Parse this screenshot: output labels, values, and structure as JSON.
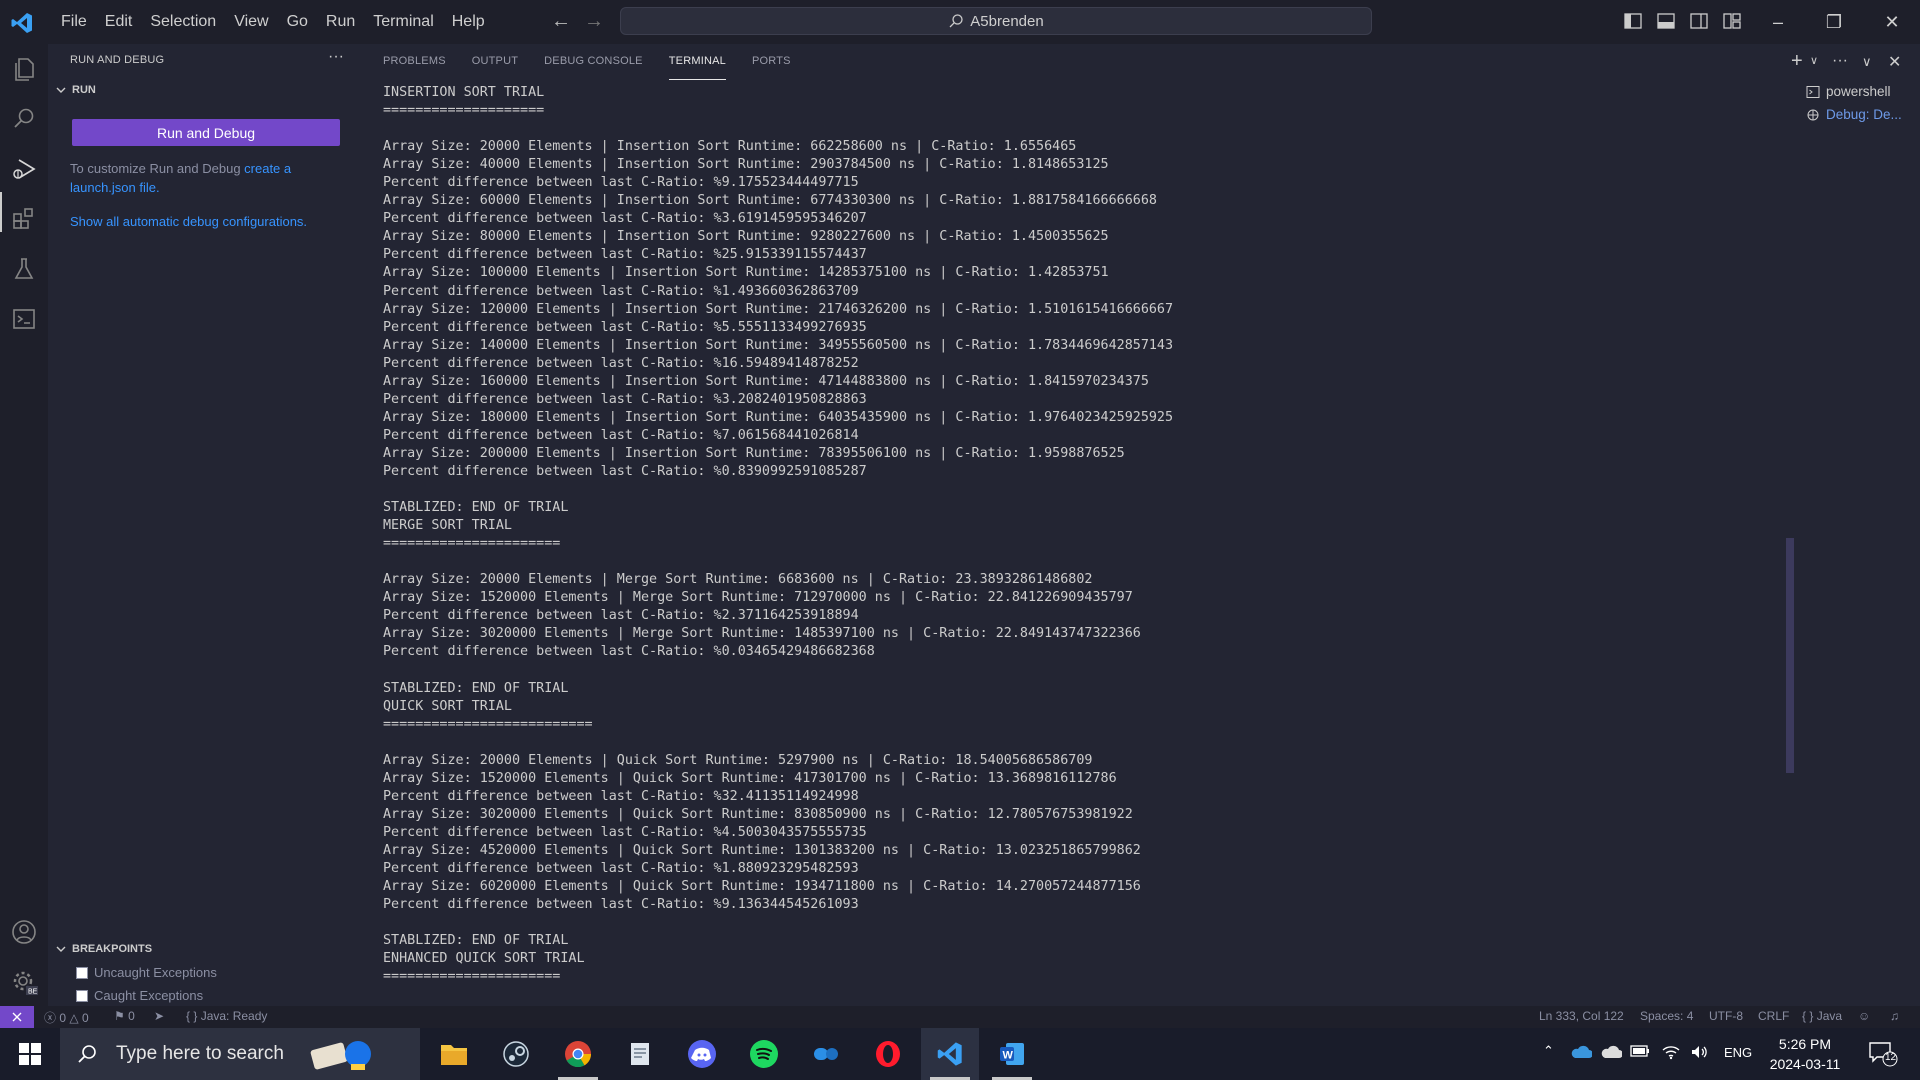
{
  "titlebar": {
    "menu": [
      "File",
      "Edit",
      "Selection",
      "View",
      "Go",
      "Run",
      "Terminal",
      "Help"
    ],
    "search_text": "A5brenden"
  },
  "sidebar": {
    "title": "RUN AND DEBUG",
    "run_section": "RUN",
    "run_button": "Run and Debug",
    "customize_text": "To customize Run and Debug ",
    "customize_link": "create a launch.json file.",
    "show_all_link": "Show all automatic debug configurations.",
    "breakpoints_section": "BREAKPOINTS",
    "breakpoints": [
      "Uncaught Exceptions",
      "Caught Exceptions"
    ]
  },
  "panel": {
    "tabs": [
      "PROBLEMS",
      "OUTPUT",
      "DEBUG CONSOLE",
      "TERMINAL",
      "PORTS"
    ],
    "active_tab": "TERMINAL",
    "terminals": [
      "powershell",
      "Debug: De..."
    ]
  },
  "terminal": {
    "lines": [
      "INSERTION SORT TRIAL",
      "====================",
      "",
      "Array Size: 20000 Elements | Insertion Sort Runtime: 662258600 ns | C-Ratio: 1.6556465",
      "Array Size: 40000 Elements | Insertion Sort Runtime: 2903784500 ns | C-Ratio: 1.8148653125",
      "Percent difference between last C-Ratio: %9.175523444497715",
      "Array Size: 60000 Elements | Insertion Sort Runtime: 6774330300 ns | C-Ratio: 1.8817584166666668",
      "Percent difference between last C-Ratio: %3.6191459595346207",
      "Array Size: 80000 Elements | Insertion Sort Runtime: 9280227600 ns | C-Ratio: 1.4500355625",
      "Percent difference between last C-Ratio: %25.915339115574437",
      "Array Size: 100000 Elements | Insertion Sort Runtime: 14285375100 ns | C-Ratio: 1.42853751",
      "Percent difference between last C-Ratio: %1.493660362863709",
      "Array Size: 120000 Elements | Insertion Sort Runtime: 21746326200 ns | C-Ratio: 1.5101615416666667",
      "Percent difference between last C-Ratio: %5.5551133499276935",
      "Array Size: 140000 Elements | Insertion Sort Runtime: 34955560500 ns | C-Ratio: 1.7834469642857143",
      "Percent difference between last C-Ratio: %16.59489414878252",
      "Array Size: 160000 Elements | Insertion Sort Runtime: 47144883800 ns | C-Ratio: 1.8415970234375",
      "Percent difference between last C-Ratio: %3.2082401950828863",
      "Array Size: 180000 Elements | Insertion Sort Runtime: 64035435900 ns | C-Ratio: 1.9764023425925925",
      "Percent difference between last C-Ratio: %7.061568441026814",
      "Array Size: 200000 Elements | Insertion Sort Runtime: 78395506100 ns | C-Ratio: 1.9598876525",
      "Percent difference between last C-Ratio: %0.8390992591085287",
      "",
      "STABLIZED: END OF TRIAL",
      "MERGE SORT TRIAL",
      "======================",
      "",
      "Array Size: 20000 Elements | Merge Sort Runtime: 6683600 ns | C-Ratio: 23.38932861486802",
      "Array Size: 1520000 Elements | Merge Sort Runtime: 712970000 ns | C-Ratio: 22.841226909435797",
      "Percent difference between last C-Ratio: %2.371164253918894",
      "Array Size: 3020000 Elements | Merge Sort Runtime: 1485397100 ns | C-Ratio: 22.849143747322366",
      "Percent difference between last C-Ratio: %0.03465429486682368",
      "",
      "STABLIZED: END OF TRIAL",
      "QUICK SORT TRIAL",
      "==========================",
      "",
      "Array Size: 20000 Elements | Quick Sort Runtime: 5297900 ns | C-Ratio: 18.54005686586709",
      "Array Size: 1520000 Elements | Quick Sort Runtime: 417301700 ns | C-Ratio: 13.3689816112786",
      "Percent difference between last C-Ratio: %32.41135114924998",
      "Array Size: 3020000 Elements | Quick Sort Runtime: 830850900 ns | C-Ratio: 12.780576753981922",
      "Percent difference between last C-Ratio: %4.5003043575555735",
      "Array Size: 4520000 Elements | Quick Sort Runtime: 1301383200 ns | C-Ratio: 13.023251865799862",
      "Percent difference between last C-Ratio: %1.880923295482593",
      "Array Size: 6020000 Elements | Quick Sort Runtime: 1934711800 ns | C-Ratio: 14.270057244877156",
      "Percent difference between last C-Ratio: %9.136344545261093",
      "",
      "STABLIZED: END OF TRIAL",
      "ENHANCED QUICK SORT TRIAL",
      "======================"
    ]
  },
  "statusbar": {
    "errors": "0",
    "warnings": "0",
    "ports": "0",
    "java_status": "Java: Ready",
    "position": "Ln 333, Col 122",
    "spaces": "Spaces: 4",
    "encoding": "UTF-8",
    "eol": "CRLF",
    "language": "Java"
  },
  "taskbar": {
    "search_placeholder": "Type here to search",
    "language": "ENG",
    "time": "5:26 PM",
    "date": "2024-03-11",
    "notifications": "12"
  },
  "colors": {
    "accent": "#7348c9",
    "link": "#3794ff",
    "background": "#232533"
  }
}
